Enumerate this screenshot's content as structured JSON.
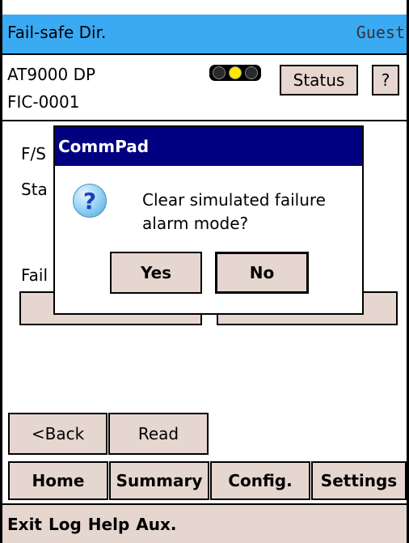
{
  "header": {
    "title": "Fail-safe Dir.",
    "user": "Guest"
  },
  "device": {
    "model": "AT9000 DP",
    "tag": "FIC-0001",
    "indicator": {
      "icon": "traffic-light-icon",
      "active_color": "#ffe800"
    },
    "status_label": "Status",
    "help_label": "?"
  },
  "background": {
    "fs_label": "F/S",
    "sta_label": "Sta",
    "fail_label": "Fail"
  },
  "nav": {
    "back_label": "<Back",
    "read_label": "Read"
  },
  "tabs": [
    {
      "label": "Home"
    },
    {
      "label": "Summary"
    },
    {
      "label": "Config."
    },
    {
      "label": "Settings"
    }
  ],
  "menu": [
    "Exit",
    "Log",
    "Help",
    "Aux."
  ],
  "dialog": {
    "title": "CommPad",
    "icon": "question-icon",
    "message": "Clear simulated failure alarm mode?",
    "yes_label": "Yes",
    "no_label": "No"
  },
  "colors": {
    "title_bar": "#3aaaf2",
    "dialog_title": "#000080",
    "button": "#e6d6d0"
  }
}
